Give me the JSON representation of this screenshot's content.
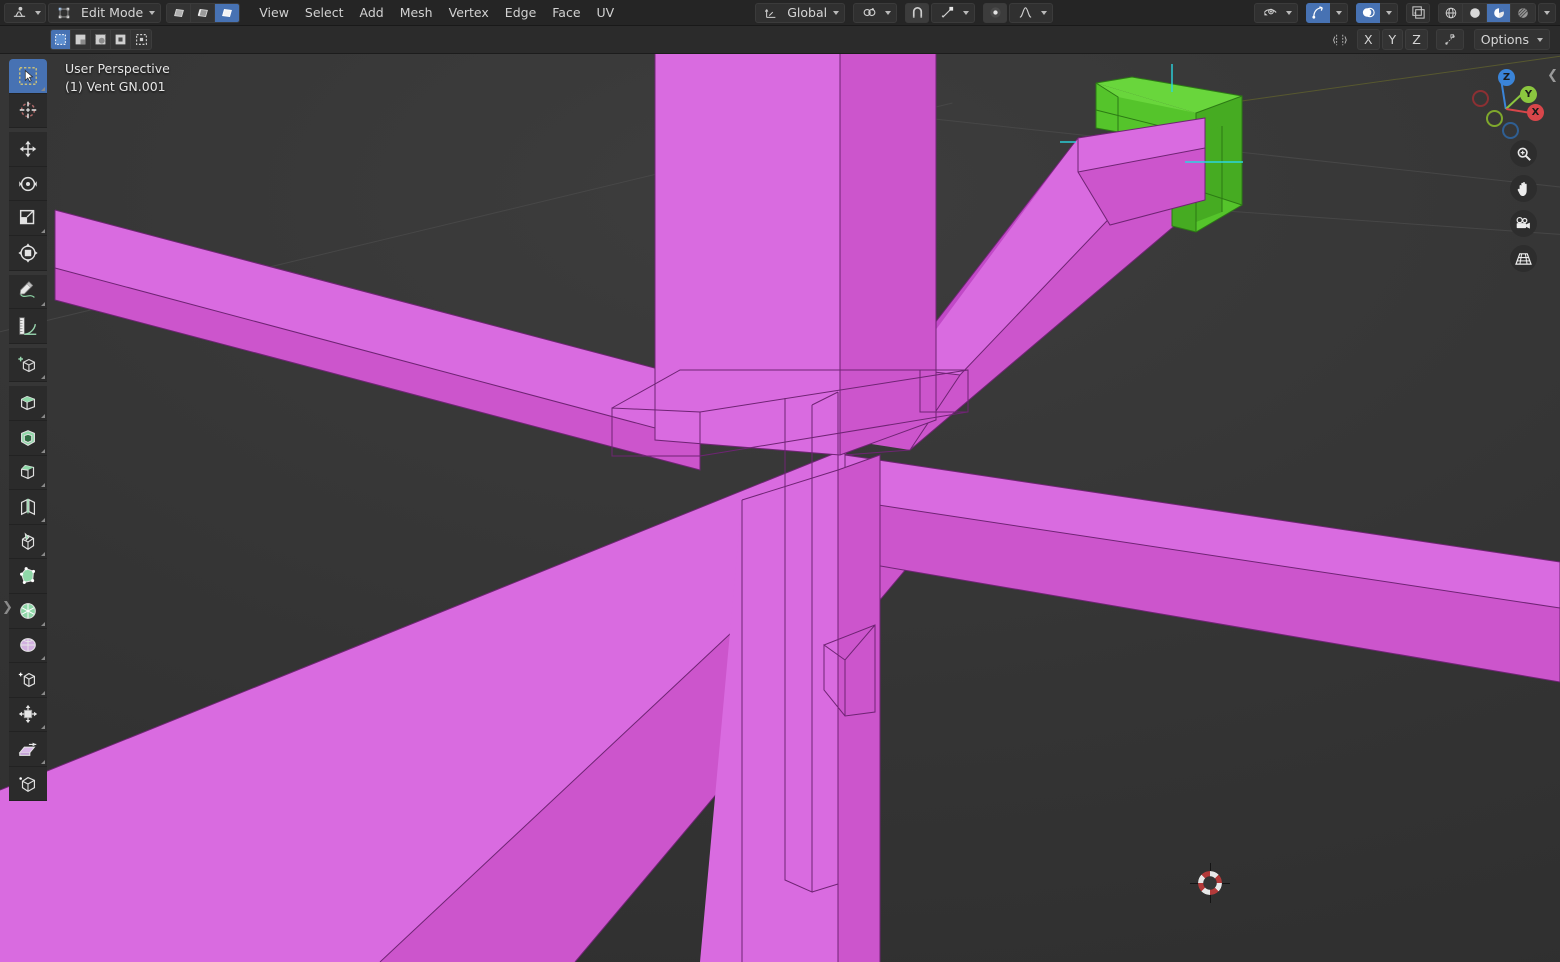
{
  "app": {
    "name": "Blender",
    "editor": "3D Viewport"
  },
  "topbar": {
    "editor_type_icon": "editor-type-icon",
    "mode": {
      "label": "Edit Mode",
      "icon": "edit-mode-icon"
    },
    "mesh_select_modes": [
      {
        "name": "vertex-select-mode",
        "icon": "vertex-icon",
        "active": false
      },
      {
        "name": "edge-select-mode",
        "icon": "edge-icon",
        "active": false
      },
      {
        "name": "face-select-mode",
        "icon": "face-icon",
        "active": true
      }
    ],
    "menus": [
      "View",
      "Select",
      "Add",
      "Mesh",
      "Vertex",
      "Edge",
      "Face",
      "UV"
    ],
    "transform_orientation": {
      "label": "Global",
      "icon": "orientation-icon"
    },
    "pivot_point": {
      "icon": "pivot-icon"
    },
    "snap_magnet": {
      "icon": "magnet-icon",
      "active": true
    },
    "snap_to": {
      "icon": "snap-vertex-icon"
    },
    "proportional_edit": {
      "icon": "proportional-icon",
      "active": true
    },
    "falloff": {
      "icon": "falloff-curve-icon"
    },
    "visibility": {
      "icon": "eye-icon"
    },
    "gizmos": {
      "icon": "gizmo-icon",
      "active": true
    },
    "overlays": {
      "icon": "overlays-icon",
      "active": true
    },
    "xray": {
      "icon": "xray-icon",
      "active": false
    },
    "shading": [
      {
        "name": "wireframe-shading",
        "icon": "wireframe-icon",
        "active": false
      },
      {
        "name": "solid-shading",
        "icon": "solid-sphere-icon",
        "active": false
      },
      {
        "name": "material-preview-shading",
        "icon": "material-preview-icon",
        "active": true
      },
      {
        "name": "rendered-shading",
        "icon": "rendered-icon",
        "active": false
      }
    ]
  },
  "header2": {
    "select_tools": [
      {
        "name": "tweak-select",
        "icon": "tweak-icon",
        "active": true
      },
      {
        "name": "box-select",
        "icon": "box-select-icon",
        "active": false
      },
      {
        "name": "circle-select",
        "icon": "circle-select-icon",
        "active": false
      },
      {
        "name": "lasso-select",
        "icon": "lasso-select-icon",
        "active": false
      },
      {
        "name": "select-all-toggle",
        "icon": "select-all-icon",
        "active": false
      }
    ],
    "mirror_label": "mirror-icon",
    "axes": [
      "X",
      "Y",
      "Z"
    ],
    "auto_merge_icon": "auto-merge-icon",
    "options_label": "Options"
  },
  "viewport_overlay": {
    "view_name": "User Perspective",
    "object_info": "(1) Vent GN.001"
  },
  "toolbar": {
    "tools": [
      {
        "name": "tweak-tool",
        "icon": "cursor-arrow-icon",
        "active": true,
        "group": 0
      },
      {
        "name": "cursor-tool",
        "icon": "3d-cursor-icon",
        "active": false,
        "group": 0
      },
      {
        "name": "move-tool",
        "icon": "move-arrows-icon",
        "active": false,
        "group": 1
      },
      {
        "name": "rotate-tool",
        "icon": "rotate-icon",
        "active": false,
        "group": 1
      },
      {
        "name": "scale-tool",
        "icon": "scale-icon",
        "active": false,
        "group": 1
      },
      {
        "name": "transform-tool",
        "icon": "transform-icon",
        "active": false,
        "group": 1
      },
      {
        "name": "annotate-tool",
        "icon": "pencil-icon",
        "active": false,
        "group": 2
      },
      {
        "name": "measure-tool",
        "icon": "ruler-icon",
        "active": false,
        "group": 2
      },
      {
        "name": "add-cube-tool",
        "icon": "add-cube-icon",
        "active": false,
        "group": 3
      },
      {
        "name": "extrude-region-tool",
        "icon": "extrude-icon",
        "active": false,
        "group": 4
      },
      {
        "name": "inset-faces-tool",
        "icon": "inset-faces-icon",
        "active": false,
        "group": 4
      },
      {
        "name": "bevel-tool",
        "icon": "bevel-icon",
        "active": false,
        "group": 4
      },
      {
        "name": "loop-cut-tool",
        "icon": "loop-cut-icon",
        "active": false,
        "group": 4
      },
      {
        "name": "knife-tool",
        "icon": "knife-icon",
        "active": false,
        "group": 4
      },
      {
        "name": "poly-build-tool",
        "icon": "poly-build-icon",
        "active": false,
        "group": 5
      },
      {
        "name": "spin-tool",
        "icon": "spin-icon",
        "active": false,
        "group": 5
      },
      {
        "name": "smooth-tool",
        "icon": "smooth-icon",
        "active": false,
        "group": 6
      },
      {
        "name": "edge-slide-tool",
        "icon": "edge-slide-icon",
        "active": false,
        "group": 6
      },
      {
        "name": "shrink-fatten-tool",
        "icon": "shrink-fatten-icon",
        "active": false,
        "group": 6
      },
      {
        "name": "shear-tool",
        "icon": "shear-icon",
        "active": false,
        "group": 6
      },
      {
        "name": "rip-region-tool",
        "icon": "rip-region-icon",
        "active": false,
        "group": 6
      }
    ]
  },
  "nav_gizmo": {
    "axes": [
      {
        "label": "Z",
        "color": "#3a84d8",
        "filled": true
      },
      {
        "label": "Y",
        "color": "#8bc63f",
        "filled": true
      },
      {
        "label": "X",
        "color": "#d8464a",
        "filled": true
      },
      {
        "label": "",
        "color": "#d8464a",
        "filled": false
      },
      {
        "label": "",
        "color": "#8bc63f",
        "filled": false
      },
      {
        "label": "",
        "color": "#3a84d8",
        "filled": false
      }
    ],
    "buttons": [
      {
        "name": "zoom-view-button",
        "icon": "magnifier-icon"
      },
      {
        "name": "pan-view-button",
        "icon": "hand-icon"
      },
      {
        "name": "camera-view-button",
        "icon": "camera-icon"
      },
      {
        "name": "toggle-orthographic-button",
        "icon": "grid-perspective-icon"
      }
    ]
  },
  "scene": {
    "mesh_color": "#cc55cc",
    "mesh_color_light": "#d764dd",
    "mesh_color_dark": "#b843be",
    "selected_color": "#4ec62a",
    "selected_color_dark": "#3ea81f",
    "wire_color": "#7a2a7f",
    "background_color": "#3a3a3a",
    "grid_color": "#4c4c4c",
    "y_axis_color": "#5b5c2f",
    "cursor_label": "3d-cursor"
  }
}
